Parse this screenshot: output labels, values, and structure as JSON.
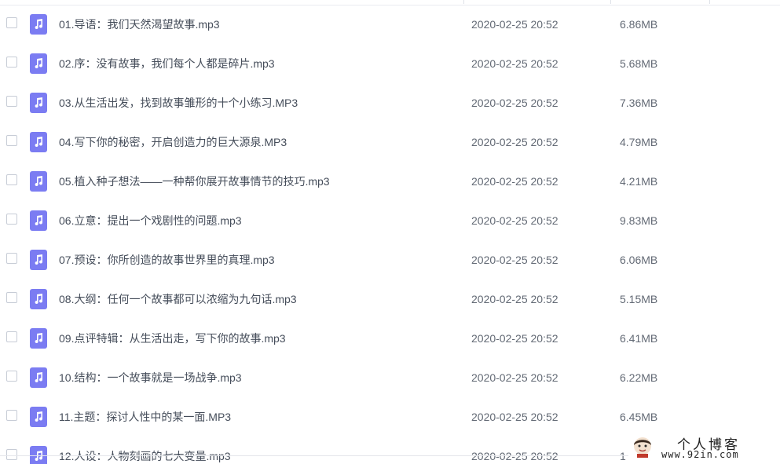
{
  "files": [
    {
      "name": "01.导语：我们天然渴望故事.mp3",
      "modified": "2020-02-25 20:52",
      "size": "6.86MB"
    },
    {
      "name": "02.序：没有故事，我们每个人都是碎片.mp3",
      "modified": "2020-02-25 20:52",
      "size": "5.68MB"
    },
    {
      "name": "03.从生活出发，找到故事雏形的十个小练习.MP3",
      "modified": "2020-02-25 20:52",
      "size": "7.36MB"
    },
    {
      "name": "04.写下你的秘密，开启创造力的巨大源泉.MP3",
      "modified": "2020-02-25 20:52",
      "size": "4.79MB"
    },
    {
      "name": "05.植入种子想法——一种帮你展开故事情节的技巧.mp3",
      "modified": "2020-02-25 20:52",
      "size": "4.21MB"
    },
    {
      "name": "06.立意：提出一个戏剧性的问题.mp3",
      "modified": "2020-02-25 20:52",
      "size": "9.83MB"
    },
    {
      "name": "07.预设：你所创造的故事世界里的真理.mp3",
      "modified": "2020-02-25 20:52",
      "size": "6.06MB"
    },
    {
      "name": "08.大纲：任何一个故事都可以浓缩为九句话.mp3",
      "modified": "2020-02-25 20:52",
      "size": "5.15MB"
    },
    {
      "name": "09.点评特辑：从生活出走，写下你的故事.mp3",
      "modified": "2020-02-25 20:52",
      "size": "6.41MB"
    },
    {
      "name": "10.结构：一个故事就是一场战争.mp3",
      "modified": "2020-02-25 20:52",
      "size": "6.22MB"
    },
    {
      "name": "11.主题：探讨人性中的某一面.MP3",
      "modified": "2020-02-25 20:52",
      "size": "6.45MB"
    },
    {
      "name": "12.人设：人物刻画的七大变量.mp3",
      "modified": "2020-02-25 20:52",
      "size": "1"
    }
  ],
  "icons": {
    "file_type": "music-note-icon",
    "file_icon_color": "#7b7cf2"
  },
  "watermark": {
    "title": "个人博客",
    "url": "www.92in.com"
  }
}
